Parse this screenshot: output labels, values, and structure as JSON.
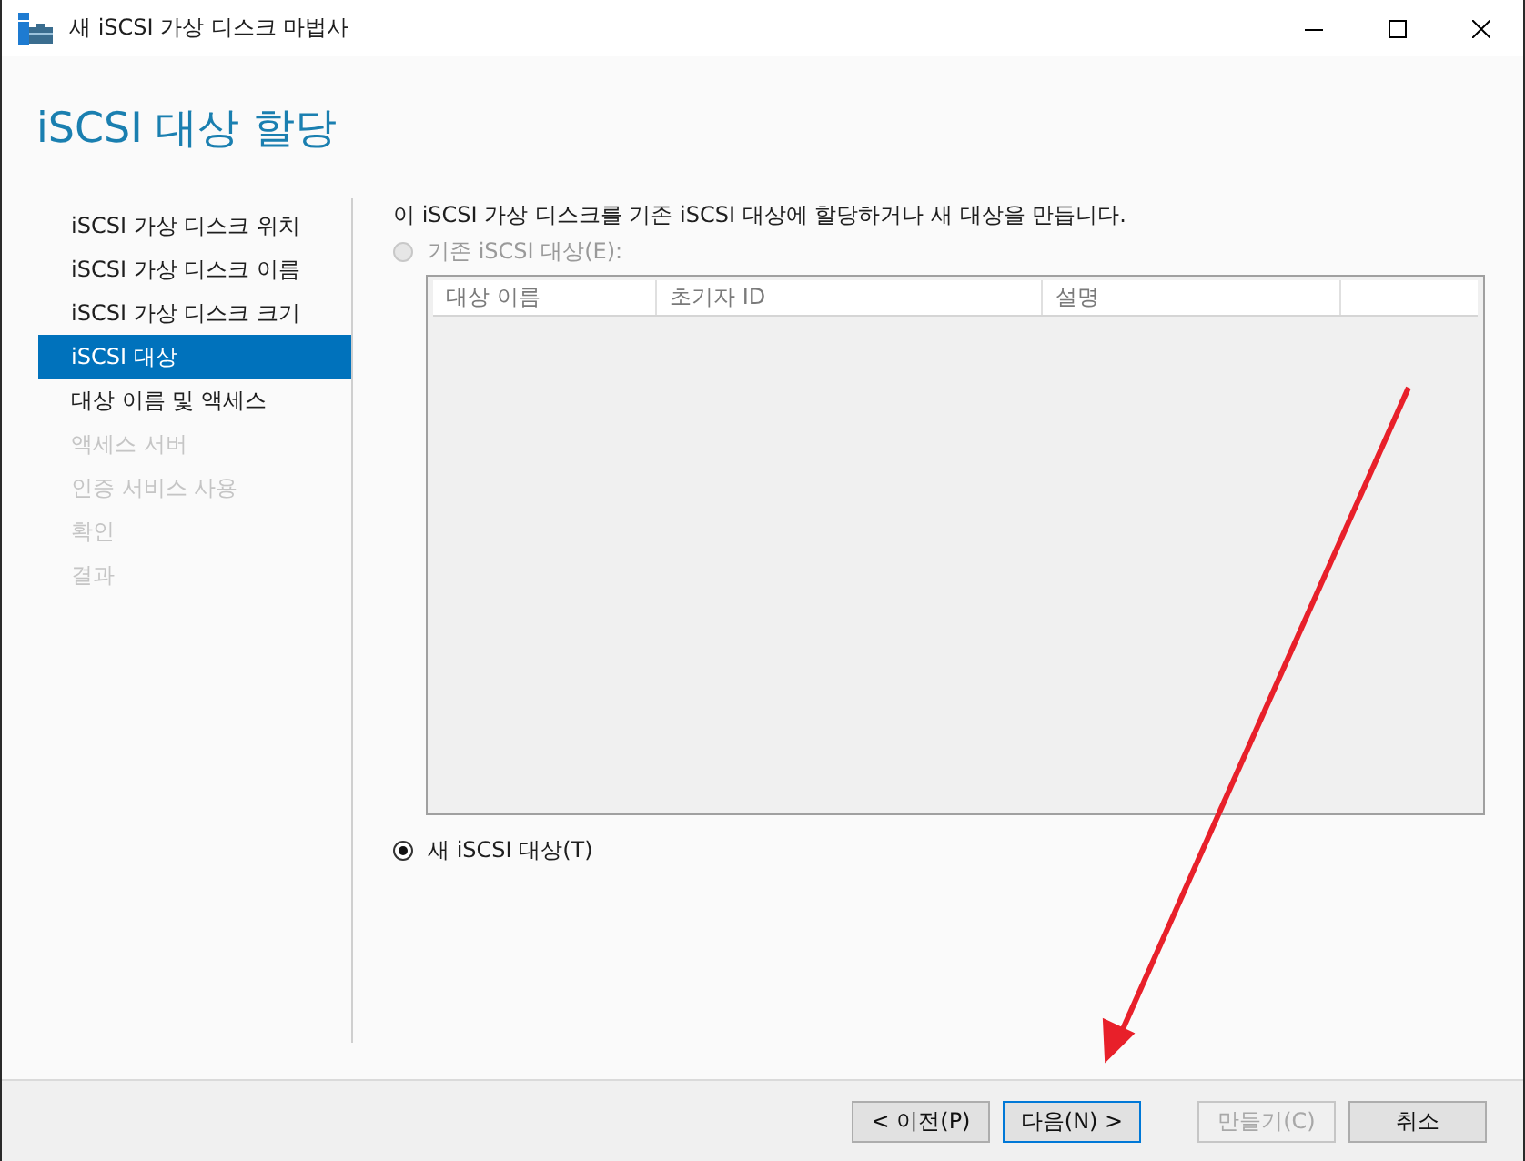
{
  "window": {
    "title": "새 iSCSI 가상 디스크 마법사"
  },
  "page_title": "iSCSI 대상 할당",
  "sidebar": {
    "items": [
      {
        "label": "iSCSI 가상 디스크 위치",
        "selected": false,
        "disabled": false
      },
      {
        "label": "iSCSI 가상 디스크 이름",
        "selected": false,
        "disabled": false
      },
      {
        "label": "iSCSI 가상 디스크 크기",
        "selected": false,
        "disabled": false
      },
      {
        "label": "iSCSI 대상",
        "selected": true,
        "disabled": false
      },
      {
        "label": "대상 이름 및 액세스",
        "selected": false,
        "disabled": false
      },
      {
        "label": "액세스 서버",
        "selected": false,
        "disabled": true
      },
      {
        "label": "인증 서비스 사용",
        "selected": false,
        "disabled": true
      },
      {
        "label": "확인",
        "selected": false,
        "disabled": true
      },
      {
        "label": "결과",
        "selected": false,
        "disabled": true
      }
    ]
  },
  "description": "이 iSCSI 가상 디스크를 기존 iSCSI 대상에 할당하거나 새 대상을 만듭니다.",
  "options": [
    {
      "label": "기존 iSCSI 대상(E):",
      "selected": false,
      "disabled": true
    },
    {
      "label": "새 iSCSI 대상(T)",
      "selected": true,
      "disabled": false
    }
  ],
  "table": {
    "columns": [
      "대상 이름",
      "초기자 ID",
      "설명"
    ]
  },
  "buttons": [
    {
      "label": "< 이전(P)",
      "disabled": false,
      "default": false
    },
    {
      "label": "다음(N) >",
      "disabled": false,
      "default": true
    },
    {
      "label": "만들기(C)",
      "disabled": true,
      "default": false
    },
    {
      "label": "취소",
      "disabled": false,
      "default": false
    }
  ]
}
